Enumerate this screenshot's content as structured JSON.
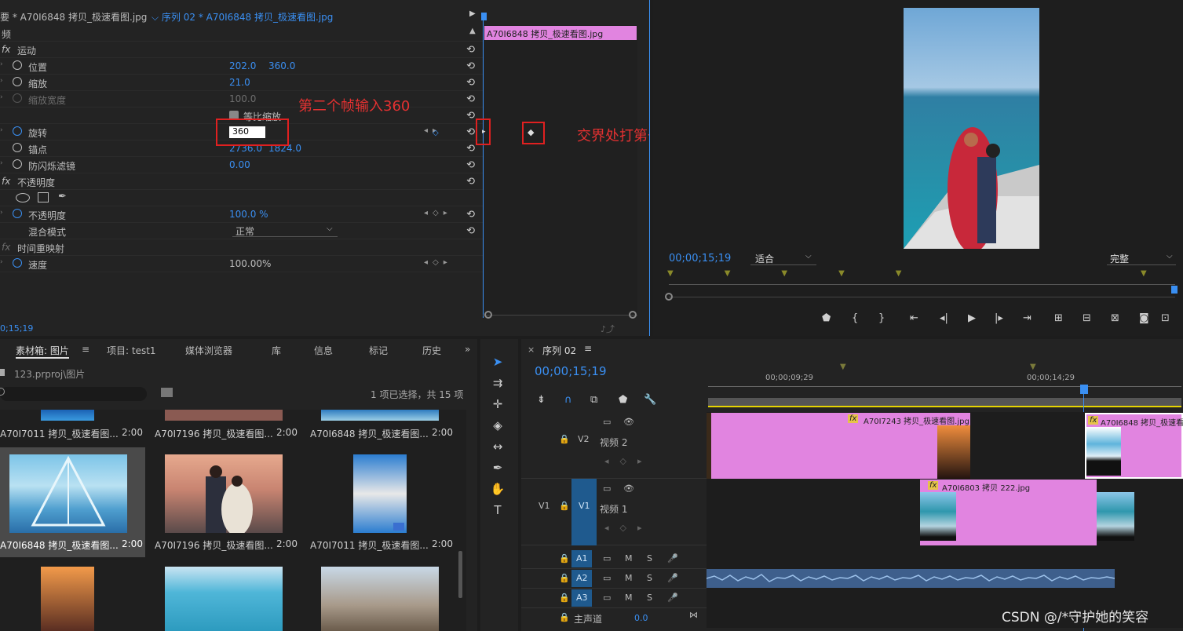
{
  "effect_controls": {
    "tab_master": "要 * A70I6848 拷贝_极速看图.jpg",
    "tab_sequence": "序列 02 * A70I6848 拷贝_极速看图.jpg",
    "video_header": "频",
    "motion": "运动",
    "position_label": "位置",
    "position_x": "202.0",
    "position_y": "360.0",
    "scale_label": "缩放",
    "scale_value": "21.0",
    "scale_width_label": "缩放宽度",
    "scale_width_value": "100.0",
    "uniform_scale_label": "等比缩放",
    "rotation_label": "旋转",
    "rotation_value": "360",
    "anchor_label": "锚点",
    "anchor_x": "2736.0",
    "anchor_y": "1824.0",
    "flicker_label": "防闪烁滤镜",
    "flicker_value": "0.00",
    "opacity_group": "不透明度",
    "opacity_label": "不透明度",
    "opacity_value": "100.0 %",
    "blend_label": "混合模式",
    "blend_value": "正常",
    "time_remap": "时间重映射",
    "speed_label": "速度",
    "speed_value": "100.00%",
    "timecode": "0;15;19",
    "clip_label": "A70I6848 拷贝_极速看图.jpg"
  },
  "annotations": {
    "second_keyframe": "第二个帧输入360",
    "first_keyframe": "交界处打第一个关键帧"
  },
  "program_monitor": {
    "timecode": "00;00;15;19",
    "fit_value": "适合",
    "quality_value": "完整"
  },
  "project_panel": {
    "tabs": [
      "素材箱: 图片",
      "项目: test1",
      "媒体浏览器",
      "库",
      "信息",
      "标记",
      "历史"
    ],
    "path": "123.prproj\\图片",
    "selection_status": "1 项已选择，共 15 项",
    "items": [
      {
        "name": "A70I7011 拷贝_极速看图...",
        "duration": "2:00"
      },
      {
        "name": "A70I7196 拷贝_极速看图...",
        "duration": "2:00"
      },
      {
        "name": "A70I6848 拷贝_极速看图...",
        "duration": "2:00"
      },
      {
        "name": "A70I6848 拷贝_极速看图...",
        "duration": "2:00"
      },
      {
        "name": "A70I7196 拷贝_极速看图...",
        "duration": "2:00"
      },
      {
        "name": "A70I7011 拷贝_极速看图...",
        "duration": "2:00"
      }
    ]
  },
  "timeline": {
    "tab": "序列 02",
    "timecode": "00;00;15;19",
    "ruler_1": "00;00;09;29",
    "ruler_2": "00;00;14;29",
    "v2_name": "视频 2",
    "v1_name": "视频 1",
    "v2_label": "V2",
    "v1_label": "V1",
    "v1_src": "V1",
    "a1": "A1",
    "a2": "A2",
    "a3": "A3",
    "master": "主声道",
    "master_value": "0.0",
    "clip_v2a": "A70I7243 拷贝_极速看图.jpg",
    "clip_v2b": "A70I6848 拷贝_极速看",
    "clip_v1": "A70I6803 拷贝 222.jpg"
  },
  "watermark": "CSDN @/*守护她的笑容"
}
